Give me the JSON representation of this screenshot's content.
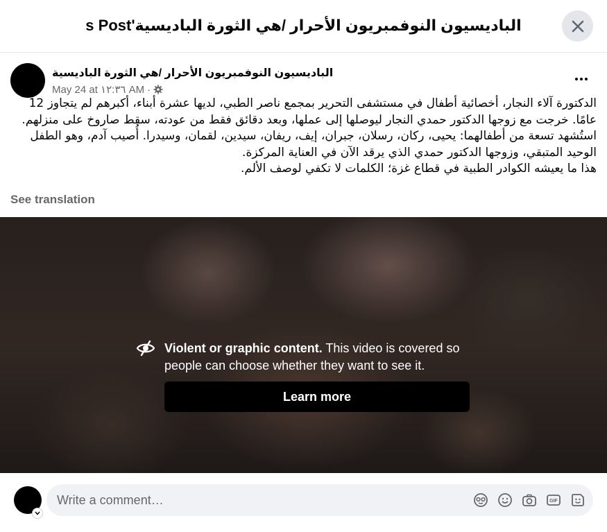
{
  "header": {
    "title": "الباديسيون النوفمبريون الأحرار /هي الثورة الباديسية's Post"
  },
  "post": {
    "author": "الباديسيون النوفمبريون الأحرار /هي الثورة الباديسية",
    "date": "May 24 at ١٢:٣٦ AM",
    "separator": "·",
    "body": [
      "الدكتورة آلاء النجار، أخصائية أطفال في مستشفى التحرير بمجمع ناصر الطبي، لديها عشرة أبناء، أكبرهم لم يتجاوز 12 عامًا. خرجت مع زوجها الدكتور حمدي النجار ليوصلها إلى عملها، وبعد دقائق فقط من عودته، سقط صاروخ على منزلهم. استُشهد تسعة من أطفالهما: يحيى، ركان، رسلان، جبران، إيف، ريفان، سيدين، لقمان، وسيدرا. أُصيب آدم، وهو الطفل الوحيد المتبقي، وزوجها الدكتور حمدي الذي يرقد الآن في العناية المركزة.",
      "هذا ما يعيشه الكوادر الطبية في قطاع غزة؛ الكلمات لا تكفي لوصف الألم."
    ],
    "see_translation": "See translation"
  },
  "video": {
    "warning_title": "Violent or graphic content.",
    "warning_body": " This video is covered so people can choose whether they want to see it.",
    "learn_more": "Learn more"
  },
  "composer": {
    "placeholder": "Write a comment…"
  },
  "icons": {
    "close": "close-icon",
    "more": "more-options-icon",
    "privacy": "gear-icon",
    "warning": "eye-slash-icon",
    "composer": [
      "avatar-sticker-icon",
      "emoji-icon",
      "camera-icon",
      "gif-icon",
      "sticker-icon"
    ]
  }
}
